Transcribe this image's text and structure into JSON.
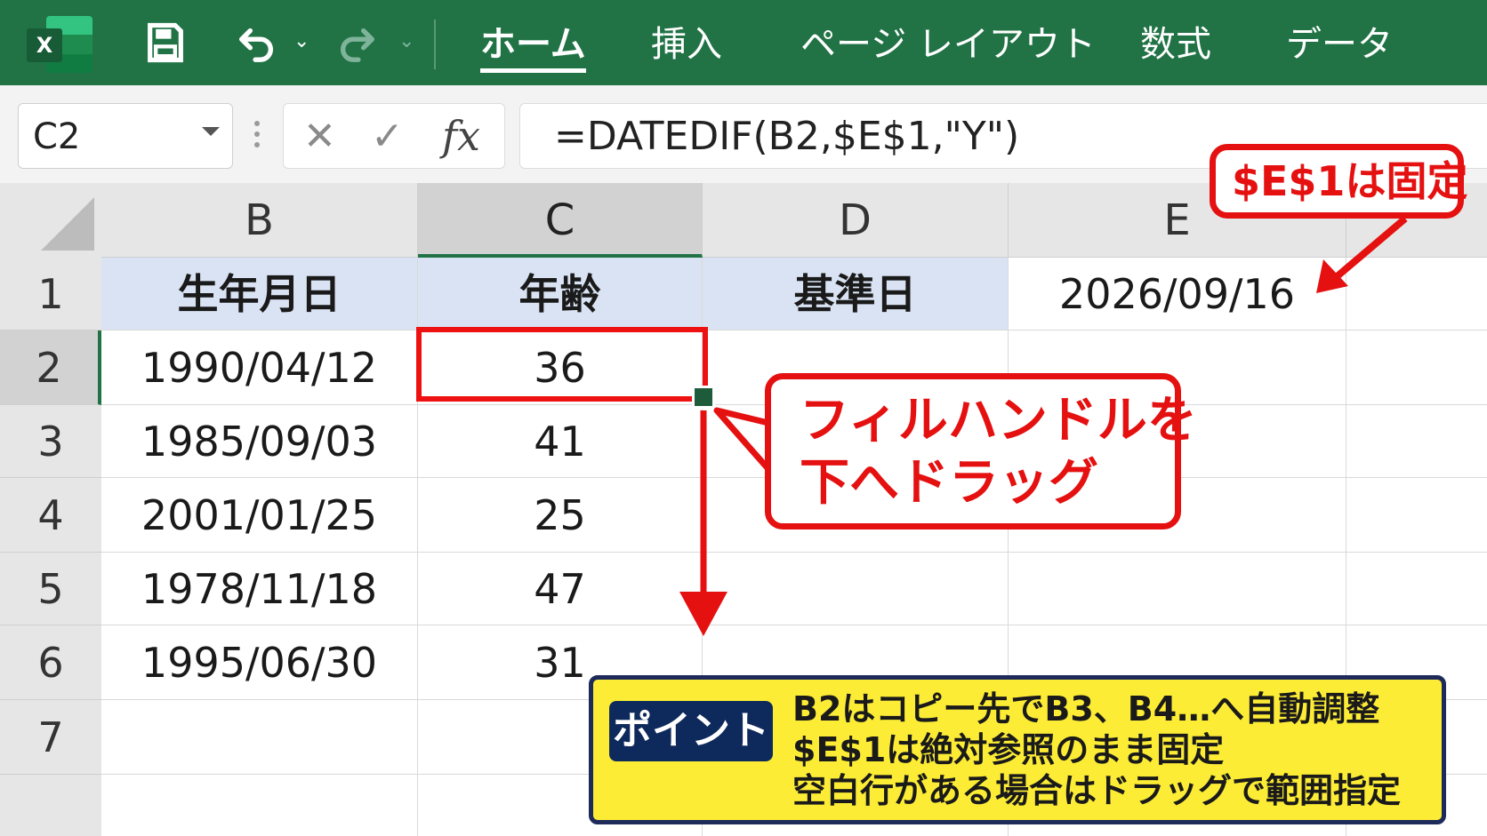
{
  "ribbon": {
    "app_icon": "excel-logo",
    "app_icon_letter": "X",
    "save_icon": "save-icon",
    "undo_icon": "undo-icon",
    "redo_icon": "redo-icon",
    "caret_glyph": "⌄",
    "tabs": [
      {
        "label": "ホーム",
        "active": true
      },
      {
        "label": "挿入"
      },
      {
        "label": "ページ レイアウト"
      },
      {
        "label": "数式"
      },
      {
        "label": "データ"
      }
    ],
    "color": "#217346"
  },
  "formula_bar": {
    "name_box": "C2",
    "cancel_glyph": "✕",
    "enter_glyph": "✓",
    "fx_label": "fx",
    "formula": "=DATEDIF(B2,$E$1,\"Y\")"
  },
  "sheet": {
    "columns": [
      "B",
      "C",
      "D",
      "E"
    ],
    "rows": [
      "1",
      "2",
      "3",
      "4",
      "5",
      "6",
      "7"
    ],
    "header_row": {
      "B": "生年月日",
      "C": "年齢",
      "D": "基準日",
      "E": "2026/09/16"
    },
    "data": [
      {
        "birth": "1990/04/12",
        "age": "36"
      },
      {
        "birth": "1985/09/03",
        "age": "41"
      },
      {
        "birth": "2001/01/25",
        "age": "25"
      },
      {
        "birth": "1978/11/18",
        "age": "47"
      },
      {
        "birth": "1995/06/30",
        "age": "31"
      }
    ],
    "selected_cell": "C2",
    "header_fill": "#dae3f3"
  },
  "annotations": {
    "e1_callout": "$E$1は固定",
    "fill_callout": [
      "フィルハンドルを",
      "下へドラッグ"
    ],
    "accent_red": "#e51010",
    "point": {
      "tag": "ポイント",
      "lines": [
        "B2はコピー先でB3、B4…へ自動調整",
        "$E$1は絶対参照のまま固定",
        "空白行がある場合はドラッグで範囲指定"
      ],
      "fill": "#fcec35",
      "tag_color": "#0e2a5c"
    }
  }
}
